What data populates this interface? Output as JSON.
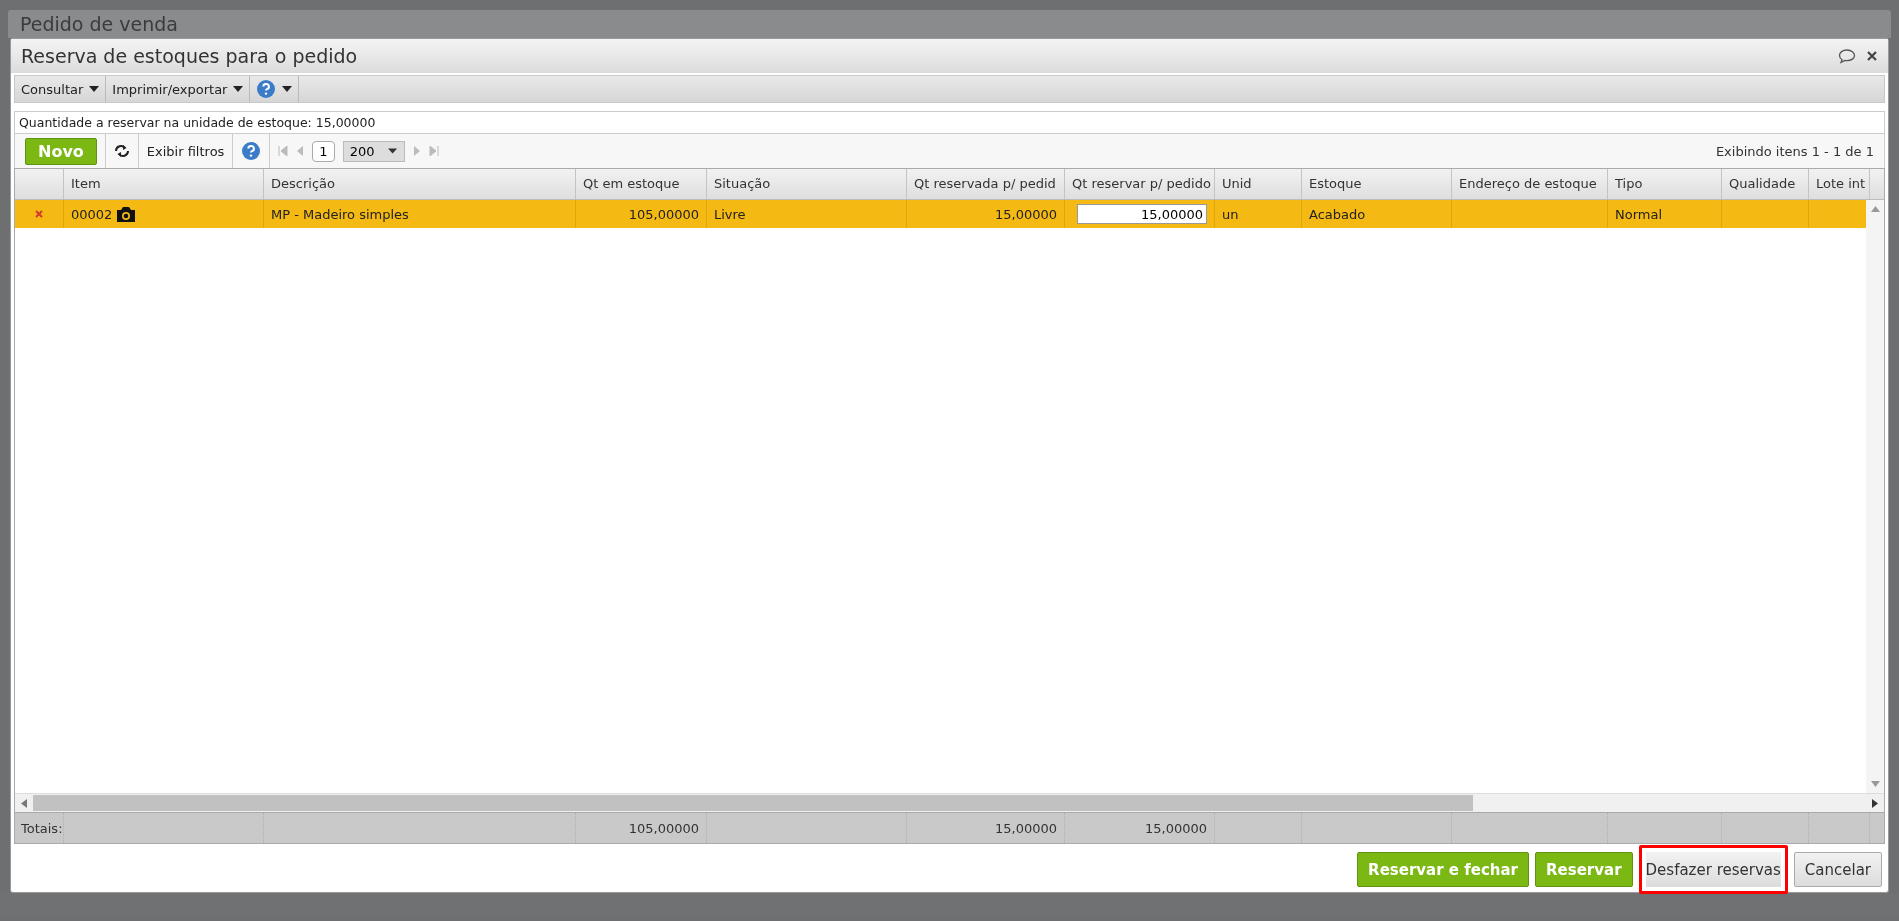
{
  "background_window": {
    "title": "Pedido de venda"
  },
  "dialog": {
    "title": "Reserva de estoques para o pedido"
  },
  "menu": [
    {
      "label": "Consultar"
    },
    {
      "label": "Imprimir/exportar"
    }
  ],
  "info": "Quantidade a reservar na unidade de estoque: 15,00000",
  "grid_toolbar": {
    "new_button": "Novo",
    "filters_button": "Exibir filtros",
    "page": "1",
    "page_size": "200",
    "summary": "Exibindo itens 1 - 1 de 1"
  },
  "table": {
    "columns": [
      {
        "label": "Item"
      },
      {
        "label": "Descrição"
      },
      {
        "label": "Qt em estoque",
        "total": "105,00000"
      },
      {
        "label": "Situação"
      },
      {
        "label": "Qt reservada p/ pedid",
        "total": "15,00000"
      },
      {
        "label": "Qt reservar p/ pedido",
        "total": "15,00000"
      },
      {
        "label": "Unid"
      },
      {
        "label": "Estoque"
      },
      {
        "label": "Endereço de estoque"
      },
      {
        "label": "Tipo"
      },
      {
        "label": "Qualidade"
      },
      {
        "label": "Lote int"
      }
    ],
    "rows": [
      {
        "selected": true,
        "cells": [
          "00002",
          "MP - Madeiro simples",
          "105,00000",
          "Livre",
          "15,00000",
          "15,00000",
          "un",
          "Acabado",
          null,
          "Normal",
          null,
          null
        ]
      }
    ],
    "totals_label": "Totais:"
  },
  "buttons": [
    {
      "label": "Reservar e fechar",
      "kind": "primary",
      "highlighted": false
    },
    {
      "label": "Reservar",
      "kind": "primary",
      "highlighted": false
    },
    {
      "label": "Desfazer reservas",
      "kind": "secondary",
      "highlighted": true
    },
    {
      "label": "Cancelar",
      "kind": "secondary",
      "highlighted": false
    }
  ]
}
